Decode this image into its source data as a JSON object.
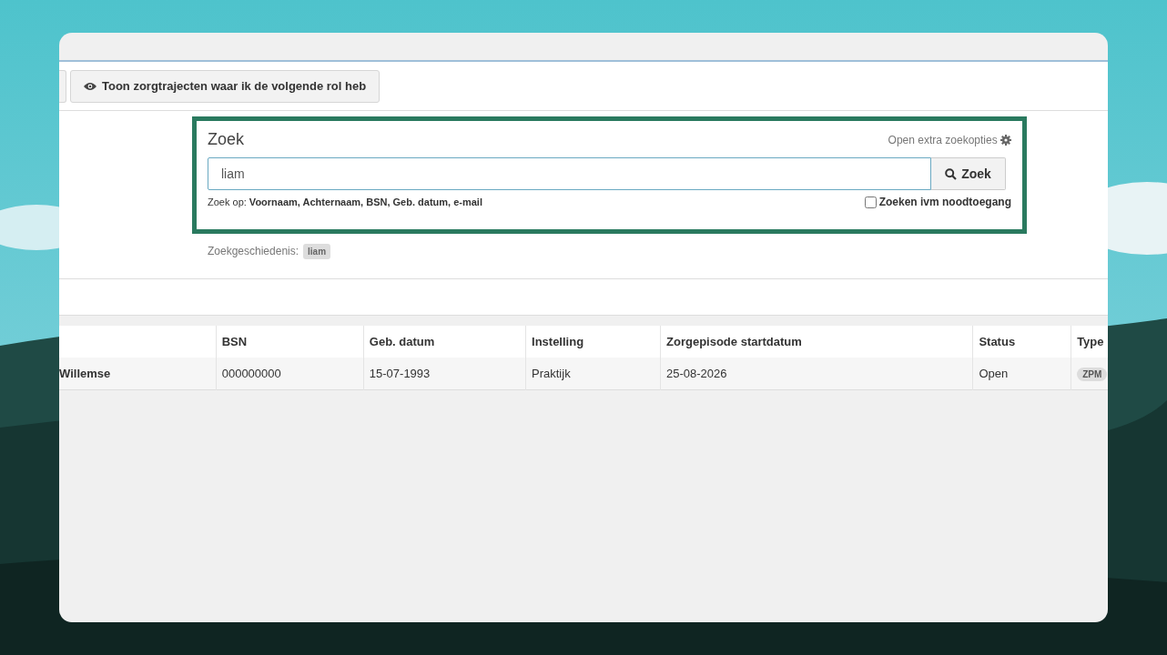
{
  "toolbar": {
    "button": "Toon zorgtrajecten waar ik de volgende rol heb"
  },
  "search": {
    "highlighted": true,
    "title": "Zoek",
    "options_link": "Open extra zoekopties",
    "value": "liam",
    "button": "Zoek",
    "hint": "Zoek op: **Voornaam, Achternaam, BSN, Geb. datum, e-mail**",
    "emergency": {
      "label": "Zoeken ivm noodtoegang",
      "checked": false
    },
    "history": {
      "label": "Zoekgeschiedenis:",
      "items": [
        "liam"
      ]
    }
  },
  "table": {
    "columns": [
      "",
      "BSN",
      "Geb. datum",
      "Instelling",
      "Zorgepisode startdatum",
      "Status",
      "Type"
    ],
    "rows": [
      {
        "cells": [
          "Willemse",
          "000000000",
          "15-07-1993",
          "Praktijk",
          "25-08-2026",
          "Open"
        ],
        "type": "ZPM"
      }
    ]
  }
}
